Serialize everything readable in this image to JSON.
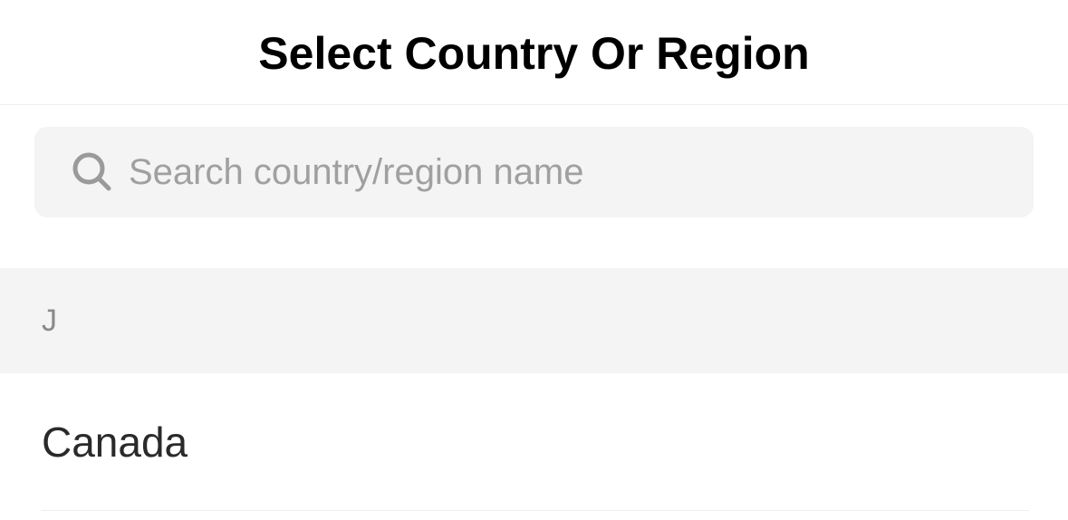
{
  "header": {
    "title": "Select Country Or Region"
  },
  "search": {
    "placeholder": "Search country/region name",
    "value": "",
    "icon": "search-icon"
  },
  "sections": [
    {
      "letter": "J",
      "items": [
        {
          "label": "Canada"
        }
      ]
    }
  ],
  "colors": {
    "background": "#ffffff",
    "search_bg": "#f4f4f4",
    "section_bg": "#f4f4f4",
    "placeholder": "#a0a0a0",
    "title": "#000000",
    "item_text": "#2a2a2a",
    "section_letter": "#8a8a8a"
  }
}
